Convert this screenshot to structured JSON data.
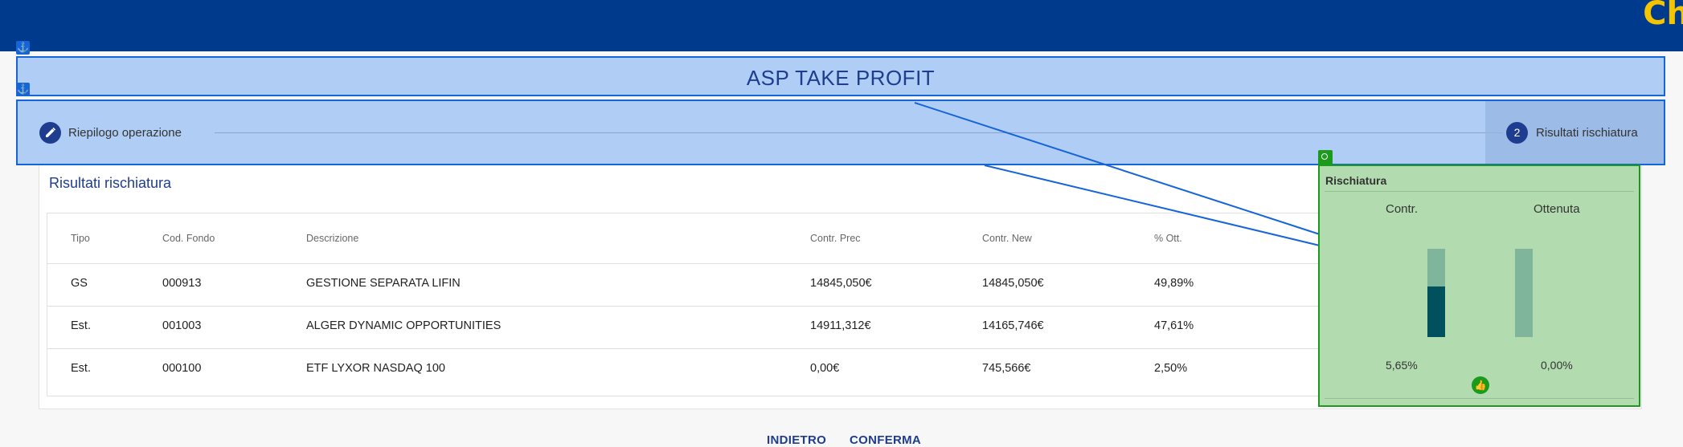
{
  "header": {
    "brand_text": "Ch"
  },
  "page_title": "ASP TAKE PROFIT",
  "stepper": {
    "step1": {
      "icon": "pencil-icon",
      "label": "Riepilogo operazione"
    },
    "step2": {
      "number": "2",
      "label": "Risultati rischiatura"
    }
  },
  "results": {
    "title": "Risultati rischiatura",
    "columns": [
      "Tipo",
      "Cod. Fondo",
      "Descrizione",
      "Contr. Prec",
      "Contr. New",
      "% Ott."
    ],
    "rows": [
      {
        "tipo": "GS",
        "cod": "000913",
        "descrizione": "GESTIONE SEPARATA LIFIN",
        "prec": "14845,050€",
        "new": "14845,050€",
        "ott": "49,89%"
      },
      {
        "tipo": "Est.",
        "cod": "001003",
        "descrizione": "ALGER DYNAMIC OPPORTUNITIES",
        "prec": "14911,312€",
        "new": "14165,746€",
        "ott": "47,61%"
      },
      {
        "tipo": "Est.",
        "cod": "000100",
        "descrizione": "ETF LYXOR NASDAQ 100",
        "prec": "0,00€",
        "new": "745,566€",
        "ott": "2,50%"
      }
    ]
  },
  "rischiatura_panel": {
    "title": "Rischiatura",
    "contr": {
      "label": "Contr.",
      "value": "5,65%",
      "fill_fraction": 0.57
    },
    "ottenuta": {
      "label": "Ottenuta",
      "value": "0,00%",
      "fill_fraction": 0.0
    },
    "status_icon": "thumbs-up-icon"
  },
  "footer": {
    "back_label": "INDIETRO",
    "confirm_label": "CONFERMA"
  },
  "colors": {
    "header_bg": "#003a8c",
    "brand_yellow": "#f5c400",
    "primary": "#1e3d8f",
    "panel_green": "#b2dcb0",
    "bar_dark": "#00505e"
  }
}
